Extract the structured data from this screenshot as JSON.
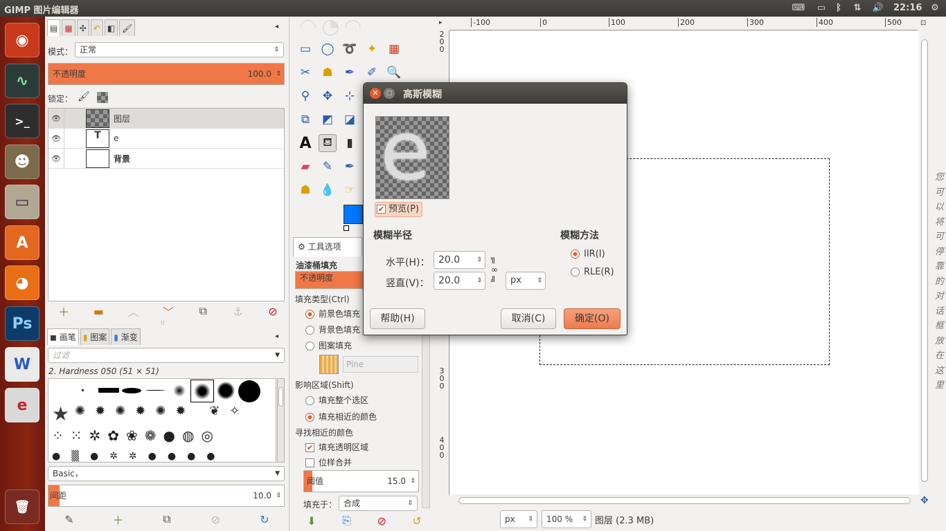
{
  "topbar": {
    "title": "GIMP 图片编辑器",
    "time": "22:16"
  },
  "launcher": {
    "items": [
      {
        "name": "ubuntu-dash",
        "label": "◉",
        "color": "#c7391a"
      },
      {
        "name": "system-monitor",
        "label": "∿",
        "color": "#2c3b38"
      },
      {
        "name": "terminal",
        "label": ">_",
        "color": "#2e2e2e"
      },
      {
        "name": "gimp",
        "label": "☻",
        "color": "#7b6b4b"
      },
      {
        "name": "files",
        "label": "▭",
        "color": "#b1a894"
      },
      {
        "name": "software-center",
        "label": "A",
        "color": "#e3681f"
      },
      {
        "name": "firefox",
        "label": "◕",
        "color": "#e86f16"
      },
      {
        "name": "photoshop",
        "label": "Ps",
        "color": "#0d3c6a"
      },
      {
        "name": "wps-writer",
        "label": "W",
        "color": "#2a5cba"
      },
      {
        "name": "pdf-viewer",
        "label": "e",
        "color": "#d9d9d9"
      }
    ]
  },
  "layers": {
    "mode_label": "模式：",
    "mode_value": "正常",
    "opacity_label": "不透明度",
    "opacity_value": "100.0",
    "lock_label": "锁定：",
    "rows": [
      {
        "name": "图层",
        "bold": false
      },
      {
        "name": "e",
        "bold": false
      },
      {
        "name": "背景",
        "bold": true
      }
    ]
  },
  "brushes": {
    "tabs": [
      "画笔",
      "图案",
      "渐变"
    ],
    "filter_placeholder": "过滤",
    "current": "2. Hardness 050 (51 × 51)",
    "set": "Basic，",
    "spacing_label": "间距",
    "spacing_value": "10.0"
  },
  "tool_options": {
    "tab": "工具选项",
    "tool_name": "油漆桶填充",
    "opacity_label": "不透明度",
    "fill_type_label": "填充类型(Ctrl)",
    "fill_fg": "前景色填充",
    "fill_bg": "背景色填充",
    "fill_pattern": "图案填充",
    "pattern_name": "Pine",
    "affected_label": "影响区域(Shift)",
    "fill_selection": "填充整个选区",
    "fill_similar": "填充相近的颜色",
    "find_similar_label": "寻找相近的颜色",
    "fill_transparent": "填充透明区域",
    "sample_merged": "位样合并",
    "threshold_label": "阈值",
    "threshold_value": "15.0",
    "fill_by_label": "填充于：",
    "fill_by_value": "合成"
  },
  "dialog": {
    "title": "高斯模糊",
    "preview_label": "预览(P)",
    "radius_label": "模糊半径",
    "horizontal_label": "水平(H)：",
    "horizontal_value": "20.0",
    "vertical_label": "竖直(V)：",
    "vertical_value": "20.0",
    "unit": "px",
    "method_label": "模糊方法",
    "method_iir": "IIR(I)",
    "method_rle": "RLE(R)",
    "help": "帮助(H)",
    "cancel": "取消(C)",
    "ok": "确定(O)"
  },
  "canvas": {
    "hruler": [
      "-100",
      "0",
      "100",
      "200",
      "300",
      "400",
      "500"
    ],
    "vruler_top": [
      "2",
      "0",
      "0"
    ],
    "vruler_mid": [
      "3",
      "0",
      "0"
    ],
    "vruler_bot": [
      "4",
      "0",
      "0"
    ],
    "side_text": [
      "您",
      "可",
      "以",
      "将",
      "可",
      "停",
      "靠",
      "的",
      "对",
      "话",
      "框",
      "放",
      "在",
      "这",
      "里"
    ]
  },
  "statusbar": {
    "unit": "px",
    "zoom": "100 %",
    "info": "图层 (2.3 MB)"
  },
  "colors": {
    "accent": "#f07746",
    "fg_color": "#0078ff",
    "launcher": "#8a2512"
  }
}
